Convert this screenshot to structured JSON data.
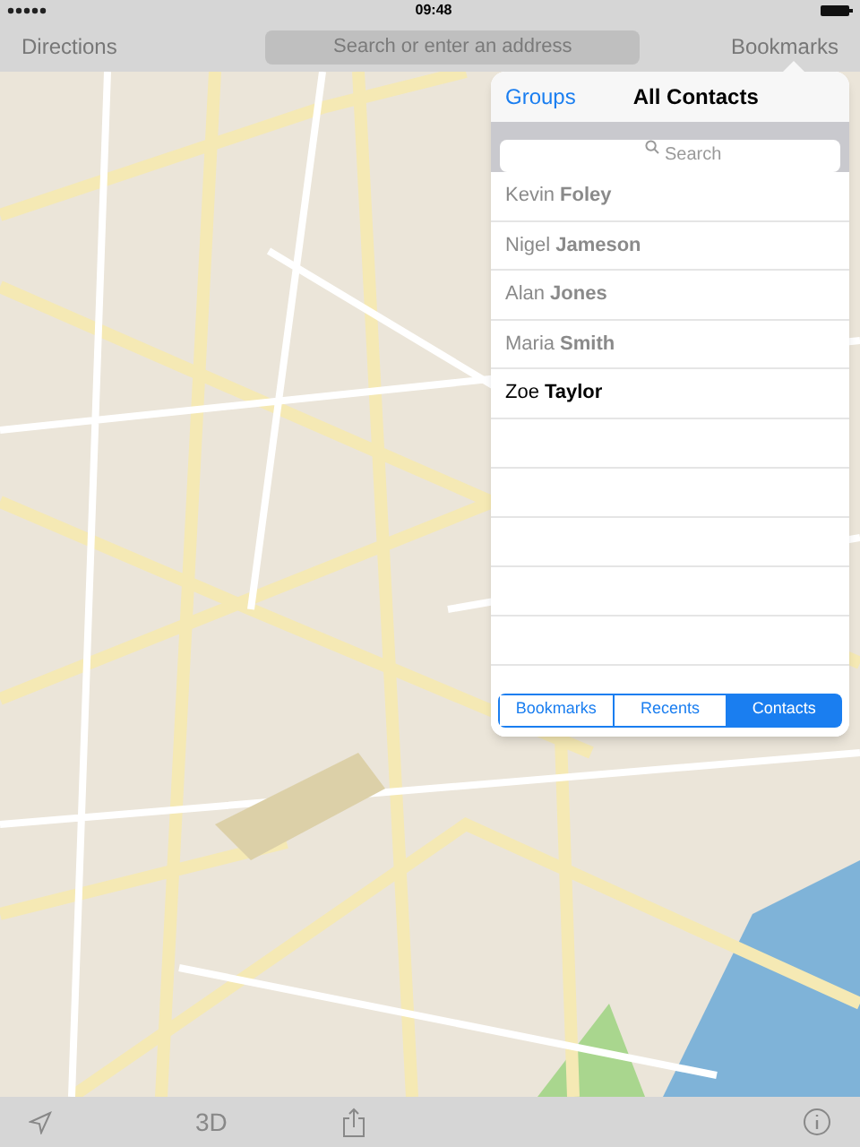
{
  "status_bar": {
    "time": "09:48"
  },
  "toolbar": {
    "left": "Directions",
    "search": {
      "placeholder": "Search or enter an address"
    },
    "right": "Bookmarks"
  },
  "popover": {
    "back": "Groups",
    "title": "All Contacts",
    "search": {
      "placeholder": "Search"
    },
    "contacts": [
      {
        "first": "Kevin",
        "last": "Foley",
        "dimmed": true
      },
      {
        "first": "Nigel",
        "last": "Jameson",
        "dimmed": true
      },
      {
        "first": "Alan",
        "last": "Jones",
        "dimmed": true
      },
      {
        "first": "Maria",
        "last": "Smith",
        "dimmed": true
      },
      {
        "first": "Zoe",
        "last": "Taylor",
        "dimmed": false
      }
    ],
    "tabs": [
      {
        "label": "Bookmarks",
        "selected": false
      },
      {
        "label": "Recents",
        "selected": false
      },
      {
        "label": "Contacts",
        "selected": true
      }
    ]
  },
  "bottom_bar": {
    "mode": "3D"
  }
}
